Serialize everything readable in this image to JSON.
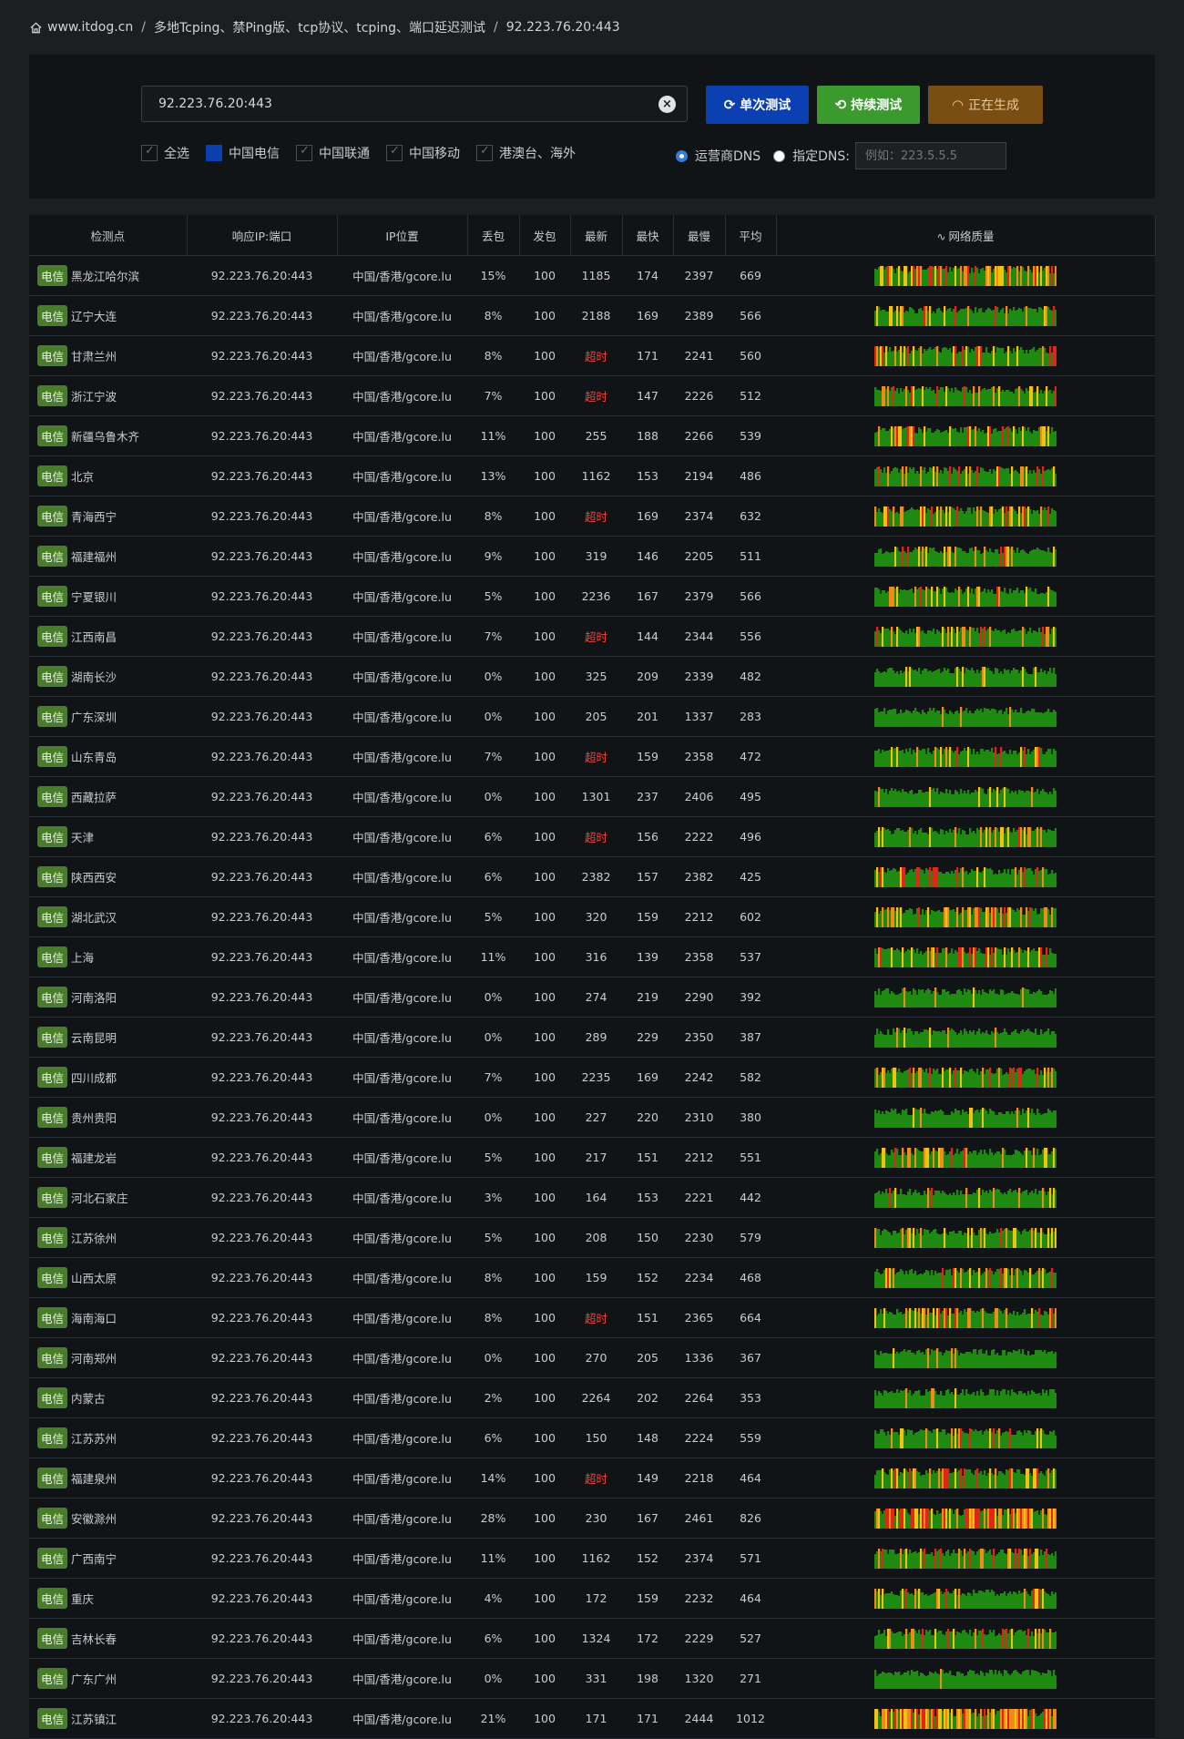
{
  "breadcrumb": {
    "site": "www.itdog.cn",
    "page": "多地Tcping、禁Ping版、tcp协议、tcping、端口延迟测试",
    "target": "92.223.76.20:443"
  },
  "search": {
    "value": "92.223.76.20:443"
  },
  "buttons": {
    "single": "单次测试",
    "continuous": "持续测试",
    "generating": "正在生成"
  },
  "filters": [
    {
      "label": "全选",
      "state": "checked"
    },
    {
      "label": "中国电信",
      "state": "selected"
    },
    {
      "label": "中国联通",
      "state": "checked"
    },
    {
      "label": "中国移动",
      "state": "checked"
    },
    {
      "label": "港澳台、海外",
      "state": "checked"
    }
  ],
  "dns": {
    "isp_label": "运营商DNS",
    "custom_label": "指定DNS:",
    "placeholder": "例如：223.5.5.5"
  },
  "columns": [
    "检测点",
    "响应IP:端口",
    "IP位置",
    "丢包",
    "发包",
    "最新",
    "最快",
    "最慢",
    "平均",
    "网络质量"
  ],
  "colors": {
    "green": "#1f8a12",
    "yellow": "#f4c10f",
    "orange": "#f08b1a",
    "red": "#e0261b"
  },
  "rows": [
    {
      "isp": "电信",
      "node": "黑龙江哈尔滨",
      "ip": "92.223.76.20:443",
      "loc": "中国/香港/gcore.lu",
      "loss": "15%",
      "sent": "100",
      "last": "1185",
      "min": "174",
      "max": "2397",
      "avg": "669",
      "timeout": false
    },
    {
      "isp": "电信",
      "node": "辽宁大连",
      "ip": "92.223.76.20:443",
      "loc": "中国/香港/gcore.lu",
      "loss": "8%",
      "sent": "100",
      "last": "2188",
      "min": "169",
      "max": "2389",
      "avg": "566",
      "timeout": false
    },
    {
      "isp": "电信",
      "node": "甘肃兰州",
      "ip": "92.223.76.20:443",
      "loc": "中国/香港/gcore.lu",
      "loss": "8%",
      "sent": "100",
      "last": "超时",
      "min": "171",
      "max": "2241",
      "avg": "560",
      "timeout": true
    },
    {
      "isp": "电信",
      "node": "浙江宁波",
      "ip": "92.223.76.20:443",
      "loc": "中国/香港/gcore.lu",
      "loss": "7%",
      "sent": "100",
      "last": "超时",
      "min": "147",
      "max": "2226",
      "avg": "512",
      "timeout": true
    },
    {
      "isp": "电信",
      "node": "新疆乌鲁木齐",
      "ip": "92.223.76.20:443",
      "loc": "中国/香港/gcore.lu",
      "loss": "11%",
      "sent": "100",
      "last": "255",
      "min": "188",
      "max": "2266",
      "avg": "539",
      "timeout": false
    },
    {
      "isp": "电信",
      "node": "北京",
      "ip": "92.223.76.20:443",
      "loc": "中国/香港/gcore.lu",
      "loss": "13%",
      "sent": "100",
      "last": "1162",
      "min": "153",
      "max": "2194",
      "avg": "486",
      "timeout": false
    },
    {
      "isp": "电信",
      "node": "青海西宁",
      "ip": "92.223.76.20:443",
      "loc": "中国/香港/gcore.lu",
      "loss": "8%",
      "sent": "100",
      "last": "超时",
      "min": "169",
      "max": "2374",
      "avg": "632",
      "timeout": true
    },
    {
      "isp": "电信",
      "node": "福建福州",
      "ip": "92.223.76.20:443",
      "loc": "中国/香港/gcore.lu",
      "loss": "9%",
      "sent": "100",
      "last": "319",
      "min": "146",
      "max": "2205",
      "avg": "511",
      "timeout": false
    },
    {
      "isp": "电信",
      "node": "宁夏银川",
      "ip": "92.223.76.20:443",
      "loc": "中国/香港/gcore.lu",
      "loss": "5%",
      "sent": "100",
      "last": "2236",
      "min": "167",
      "max": "2379",
      "avg": "566",
      "timeout": false
    },
    {
      "isp": "电信",
      "node": "江西南昌",
      "ip": "92.223.76.20:443",
      "loc": "中国/香港/gcore.lu",
      "loss": "7%",
      "sent": "100",
      "last": "超时",
      "min": "144",
      "max": "2344",
      "avg": "556",
      "timeout": true
    },
    {
      "isp": "电信",
      "node": "湖南长沙",
      "ip": "92.223.76.20:443",
      "loc": "中国/香港/gcore.lu",
      "loss": "0%",
      "sent": "100",
      "last": "325",
      "min": "209",
      "max": "2339",
      "avg": "482",
      "timeout": false
    },
    {
      "isp": "电信",
      "node": "广东深圳",
      "ip": "92.223.76.20:443",
      "loc": "中国/香港/gcore.lu",
      "loss": "0%",
      "sent": "100",
      "last": "205",
      "min": "201",
      "max": "1337",
      "avg": "283",
      "timeout": false
    },
    {
      "isp": "电信",
      "node": "山东青岛",
      "ip": "92.223.76.20:443",
      "loc": "中国/香港/gcore.lu",
      "loss": "7%",
      "sent": "100",
      "last": "超时",
      "min": "159",
      "max": "2358",
      "avg": "472",
      "timeout": true
    },
    {
      "isp": "电信",
      "node": "西藏拉萨",
      "ip": "92.223.76.20:443",
      "loc": "中国/香港/gcore.lu",
      "loss": "0%",
      "sent": "100",
      "last": "1301",
      "min": "237",
      "max": "2406",
      "avg": "495",
      "timeout": false
    },
    {
      "isp": "电信",
      "node": "天津",
      "ip": "92.223.76.20:443",
      "loc": "中国/香港/gcore.lu",
      "loss": "6%",
      "sent": "100",
      "last": "超时",
      "min": "156",
      "max": "2222",
      "avg": "496",
      "timeout": true
    },
    {
      "isp": "电信",
      "node": "陕西西安",
      "ip": "92.223.76.20:443",
      "loc": "中国/香港/gcore.lu",
      "loss": "6%",
      "sent": "100",
      "last": "2382",
      "min": "157",
      "max": "2382",
      "avg": "425",
      "timeout": false
    },
    {
      "isp": "电信",
      "node": "湖北武汉",
      "ip": "92.223.76.20:443",
      "loc": "中国/香港/gcore.lu",
      "loss": "5%",
      "sent": "100",
      "last": "320",
      "min": "159",
      "max": "2212",
      "avg": "602",
      "timeout": false
    },
    {
      "isp": "电信",
      "node": "上海",
      "ip": "92.223.76.20:443",
      "loc": "中国/香港/gcore.lu",
      "loss": "11%",
      "sent": "100",
      "last": "316",
      "min": "139",
      "max": "2358",
      "avg": "537",
      "timeout": false
    },
    {
      "isp": "电信",
      "node": "河南洛阳",
      "ip": "92.223.76.20:443",
      "loc": "中国/香港/gcore.lu",
      "loss": "0%",
      "sent": "100",
      "last": "274",
      "min": "219",
      "max": "2290",
      "avg": "392",
      "timeout": false
    },
    {
      "isp": "电信",
      "node": "云南昆明",
      "ip": "92.223.76.20:443",
      "loc": "中国/香港/gcore.lu",
      "loss": "0%",
      "sent": "100",
      "last": "289",
      "min": "229",
      "max": "2350",
      "avg": "387",
      "timeout": false
    },
    {
      "isp": "电信",
      "node": "四川成都",
      "ip": "92.223.76.20:443",
      "loc": "中国/香港/gcore.lu",
      "loss": "7%",
      "sent": "100",
      "last": "2235",
      "min": "169",
      "max": "2242",
      "avg": "582",
      "timeout": false
    },
    {
      "isp": "电信",
      "node": "贵州贵阳",
      "ip": "92.223.76.20:443",
      "loc": "中国/香港/gcore.lu",
      "loss": "0%",
      "sent": "100",
      "last": "227",
      "min": "220",
      "max": "2310",
      "avg": "380",
      "timeout": false
    },
    {
      "isp": "电信",
      "node": "福建龙岩",
      "ip": "92.223.76.20:443",
      "loc": "中国/香港/gcore.lu",
      "loss": "5%",
      "sent": "100",
      "last": "217",
      "min": "151",
      "max": "2212",
      "avg": "551",
      "timeout": false
    },
    {
      "isp": "电信",
      "node": "河北石家庄",
      "ip": "92.223.76.20:443",
      "loc": "中国/香港/gcore.lu",
      "loss": "3%",
      "sent": "100",
      "last": "164",
      "min": "153",
      "max": "2221",
      "avg": "442",
      "timeout": false
    },
    {
      "isp": "电信",
      "node": "江苏徐州",
      "ip": "92.223.76.20:443",
      "loc": "中国/香港/gcore.lu",
      "loss": "5%",
      "sent": "100",
      "last": "208",
      "min": "150",
      "max": "2230",
      "avg": "579",
      "timeout": false
    },
    {
      "isp": "电信",
      "node": "山西太原",
      "ip": "92.223.76.20:443",
      "loc": "中国/香港/gcore.lu",
      "loss": "8%",
      "sent": "100",
      "last": "159",
      "min": "152",
      "max": "2234",
      "avg": "468",
      "timeout": false
    },
    {
      "isp": "电信",
      "node": "海南海口",
      "ip": "92.223.76.20:443",
      "loc": "中国/香港/gcore.lu",
      "loss": "8%",
      "sent": "100",
      "last": "超时",
      "min": "151",
      "max": "2365",
      "avg": "664",
      "timeout": true
    },
    {
      "isp": "电信",
      "node": "河南郑州",
      "ip": "92.223.76.20:443",
      "loc": "中国/香港/gcore.lu",
      "loss": "0%",
      "sent": "100",
      "last": "270",
      "min": "205",
      "max": "1336",
      "avg": "367",
      "timeout": false
    },
    {
      "isp": "电信",
      "node": "内蒙古",
      "ip": "92.223.76.20:443",
      "loc": "中国/香港/gcore.lu",
      "loss": "2%",
      "sent": "100",
      "last": "2264",
      "min": "202",
      "max": "2264",
      "avg": "353",
      "timeout": false
    },
    {
      "isp": "电信",
      "node": "江苏苏州",
      "ip": "92.223.76.20:443",
      "loc": "中国/香港/gcore.lu",
      "loss": "6%",
      "sent": "100",
      "last": "150",
      "min": "148",
      "max": "2224",
      "avg": "559",
      "timeout": false
    },
    {
      "isp": "电信",
      "node": "福建泉州",
      "ip": "92.223.76.20:443",
      "loc": "中国/香港/gcore.lu",
      "loss": "14%",
      "sent": "100",
      "last": "超时",
      "min": "149",
      "max": "2218",
      "avg": "464",
      "timeout": true
    },
    {
      "isp": "电信",
      "node": "安徽滁州",
      "ip": "92.223.76.20:443",
      "loc": "中国/香港/gcore.lu",
      "loss": "28%",
      "sent": "100",
      "last": "230",
      "min": "167",
      "max": "2461",
      "avg": "826",
      "timeout": false
    },
    {
      "isp": "电信",
      "node": "广西南宁",
      "ip": "92.223.76.20:443",
      "loc": "中国/香港/gcore.lu",
      "loss": "11%",
      "sent": "100",
      "last": "1162",
      "min": "152",
      "max": "2374",
      "avg": "571",
      "timeout": false
    },
    {
      "isp": "电信",
      "node": "重庆",
      "ip": "92.223.76.20:443",
      "loc": "中国/香港/gcore.lu",
      "loss": "4%",
      "sent": "100",
      "last": "172",
      "min": "159",
      "max": "2232",
      "avg": "464",
      "timeout": false
    },
    {
      "isp": "电信",
      "node": "吉林长春",
      "ip": "92.223.76.20:443",
      "loc": "中国/香港/gcore.lu",
      "loss": "6%",
      "sent": "100",
      "last": "1324",
      "min": "172",
      "max": "2229",
      "avg": "527",
      "timeout": false
    },
    {
      "isp": "电信",
      "node": "广东广州",
      "ip": "92.223.76.20:443",
      "loc": "中国/香港/gcore.lu",
      "loss": "0%",
      "sent": "100",
      "last": "331",
      "min": "198",
      "max": "1320",
      "avg": "271",
      "timeout": false
    },
    {
      "isp": "电信",
      "node": "江苏镇江",
      "ip": "92.223.76.20:443",
      "loc": "中国/香港/gcore.lu",
      "loss": "21%",
      "sent": "100",
      "last": "171",
      "min": "171",
      "max": "2444",
      "avg": "1012",
      "timeout": false
    }
  ]
}
